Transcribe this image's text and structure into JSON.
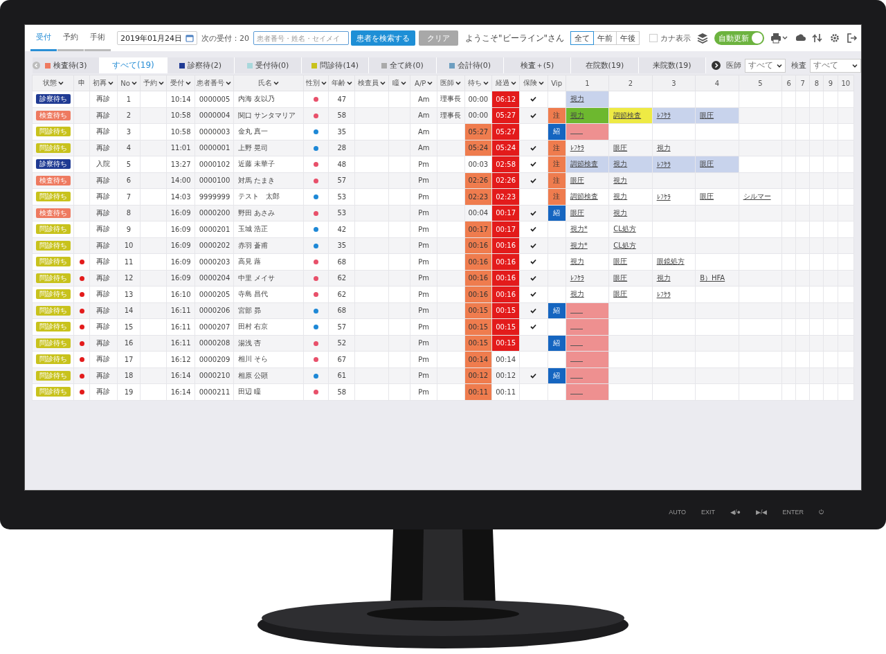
{
  "header": {
    "tabs": [
      {
        "label": "受付",
        "selected": true
      },
      {
        "label": "予約",
        "selected": false
      },
      {
        "label": "手術",
        "selected": false
      }
    ],
    "date": "2019年01月24日",
    "next_reception": "次の受付：20",
    "search": {
      "placeholder": "患者番号・姓名・セイメイ"
    },
    "buttons": [
      {
        "label": "患者を検索する",
        "disabled": false
      },
      {
        "label": "クリア",
        "disabled": true
      }
    ],
    "welcome": "ようこそ\"ビーライン\"さん",
    "period": [
      {
        "label": "全て",
        "selected": true
      },
      {
        "label": "午前",
        "selected": false
      },
      {
        "label": "午後",
        "selected": false
      }
    ],
    "kana": {
      "label": "カナ表示",
      "checked": false
    },
    "auto_update": {
      "label": "自動更新",
      "on": true
    }
  },
  "filters": {
    "tabs": [
      {
        "label": "検査待(3)",
        "color": "#ee7a60",
        "selected": false
      },
      {
        "label": "すべて(19)",
        "selected": true
      },
      {
        "label": "診察待(2)",
        "color": "#1f3a93",
        "selected": false
      },
      {
        "label": "受付待(0)",
        "color": "#a8d8dc",
        "selected": false
      },
      {
        "label": "問診待(14)",
        "color": "#c8c21c",
        "selected": false
      },
      {
        "label": "全て終(0)",
        "color": "#aaaaaa",
        "selected": false
      },
      {
        "label": "会計待(0)",
        "color": "#6d9ec0",
        "selected": false
      },
      {
        "label": "検査＋(5)",
        "selected": false
      },
      {
        "label": "在院数(19)",
        "selected": false
      },
      {
        "label": "来院数(19)",
        "selected": false
      }
    ],
    "selects": [
      {
        "label": "医師",
        "value": "すべて"
      },
      {
        "label": "検査",
        "value": "すべて"
      }
    ]
  },
  "table": {
    "columns": [
      {
        "label": "状態",
        "sortable": true
      },
      {
        "label": "申",
        "sortable": false
      },
      {
        "label": "初再",
        "sortable": true
      },
      {
        "label": "No",
        "sortable": true
      },
      {
        "label": "予約",
        "sortable": true
      },
      {
        "label": "受付",
        "sortable": true
      },
      {
        "label": "患者番号",
        "sortable": true
      },
      {
        "label": "氏名",
        "sortable": true
      },
      {
        "label": "性別",
        "sortable": true
      },
      {
        "label": "年齢",
        "sortable": true
      },
      {
        "label": "検査員",
        "sortable": true
      },
      {
        "label": "瞳",
        "sortable": true
      },
      {
        "label": "A/P",
        "sortable": true
      },
      {
        "label": "医師",
        "sortable": true
      },
      {
        "label": "待ち",
        "sortable": true
      },
      {
        "label": "経過",
        "sortable": true
      },
      {
        "label": "保険",
        "sortable": true
      },
      {
        "label": "Vip",
        "sortable": false
      },
      {
        "label": "1",
        "sortable": false
      },
      {
        "label": "2",
        "sortable": false
      },
      {
        "label": "3",
        "sortable": false
      },
      {
        "label": "4",
        "sortable": false
      },
      {
        "label": "5",
        "sortable": false
      },
      {
        "label": "6",
        "sortable": false
      },
      {
        "label": "7",
        "sortable": false
      },
      {
        "label": "8",
        "sortable": false
      },
      {
        "label": "9",
        "sortable": false
      },
      {
        "label": "10",
        "sortable": false
      }
    ],
    "rows": [
      {
        "status": {
          "label": "診察待ち",
          "color": "#1f3a93"
        },
        "flag": false,
        "visit": "再診",
        "no": "1",
        "time": "10:14",
        "patient_id": "0000005",
        "name": "内海 友以乃",
        "sex": {
          "color": "#e8506a"
        },
        "age": "47",
        "ap": "Am",
        "doctor": "理事長",
        "wait": {
          "text": "00:00",
          "alert": false
        },
        "elapsed": {
          "text": "06:12",
          "alert": true
        },
        "insured": true,
        "exams": [
          {
            "kind": "link",
            "text": "視力",
            "color": "#c8d3ec"
          }
        ]
      },
      {
        "status": {
          "label": "検査待ち",
          "color": "#ee7a60"
        },
        "flag": false,
        "visit": "再診",
        "no": "2",
        "time": "10:58",
        "patient_id": "0000004",
        "name": "関口 サンタマリア",
        "sex": {
          "color": "#e8506a"
        },
        "age": "58",
        "ap": "Am",
        "doctor": "理事長",
        "wait": {
          "text": "00:00",
          "alert": false
        },
        "elapsed": {
          "text": "05:27",
          "alert": true
        },
        "insured": true,
        "vip": {
          "kind": "caution",
          "label": "注"
        },
        "exams": [
          {
            "kind": "link",
            "text": "視力",
            "color": "#6db82f"
          },
          {
            "kind": "link",
            "text": "調節検査",
            "color": "#eeea44"
          },
          {
            "kind": "link",
            "text": "ﾚﾌｹﾗ",
            "color": "#c8d3ec"
          },
          {
            "kind": "link",
            "text": "眼圧",
            "color": "#c8d3ec"
          }
        ]
      },
      {
        "status": {
          "label": "問診待ち",
          "color": "#c8c21c"
        },
        "flag": false,
        "visit": "再診",
        "no": "3",
        "time": "10:58",
        "patient_id": "0000003",
        "name": "金丸 真一",
        "sex": {
          "color": "#1e88d6"
        },
        "age": "35",
        "ap": "Am",
        "wait": {
          "text": "05:27",
          "alert": true
        },
        "elapsed": {
          "text": "05:27",
          "alert": true
        },
        "insured": false,
        "vip": {
          "kind": "referral",
          "label": "紹"
        },
        "exams": [
          {
            "kind": "blank",
            "color": "#ee9090"
          }
        ]
      },
      {
        "status": {
          "label": "問診待ち",
          "color": "#c8c21c"
        },
        "flag": false,
        "visit": "再診",
        "no": "4",
        "time": "11:01",
        "patient_id": "0000001",
        "name": "上野 晃司",
        "sex": {
          "color": "#1e88d6"
        },
        "age": "28",
        "ap": "Am",
        "wait": {
          "text": "05:24",
          "alert": true
        },
        "elapsed": {
          "text": "05:24",
          "alert": true
        },
        "insured": true,
        "vip": {
          "kind": "caution",
          "label": "注"
        },
        "exams": [
          {
            "kind": "link",
            "text": "ﾚﾌｹﾗ"
          },
          {
            "kind": "link",
            "text": "眼圧"
          },
          {
            "kind": "link",
            "text": "視力"
          }
        ]
      },
      {
        "status": {
          "label": "診察待ち",
          "color": "#1f3a93"
        },
        "flag": false,
        "visit": "入院",
        "no": "5",
        "time": "13:27",
        "patient_id": "0000102",
        "name": "近藤 未華子",
        "sex": {
          "color": "#e8506a"
        },
        "age": "48",
        "ap": "Pm",
        "wait": {
          "text": "00:03",
          "alert": false
        },
        "elapsed": {
          "text": "02:58",
          "alert": true
        },
        "insured": true,
        "vip": {
          "kind": "caution",
          "label": "注"
        },
        "exams": [
          {
            "kind": "link",
            "text": "調節検査",
            "color": "#c8d3ec"
          },
          {
            "kind": "link",
            "text": "視力",
            "color": "#c8d3ec"
          },
          {
            "kind": "link",
            "text": "ﾚﾌｹﾗ",
            "color": "#c8d3ec"
          },
          {
            "kind": "link",
            "text": "眼圧",
            "color": "#c8d3ec"
          }
        ]
      },
      {
        "status": {
          "label": "検査待ち",
          "color": "#ee7a60"
        },
        "flag": false,
        "visit": "再診",
        "no": "6",
        "time": "14:00",
        "patient_id": "0000100",
        "name": "対馬 たまき",
        "sex": {
          "color": "#e8506a"
        },
        "age": "57",
        "ap": "Pm",
        "wait": {
          "text": "02:26",
          "alert": true
        },
        "elapsed": {
          "text": "02:26",
          "alert": true
        },
        "insured": true,
        "vip": {
          "kind": "caution",
          "label": "注"
        },
        "exams": [
          {
            "kind": "link",
            "text": "眼圧"
          },
          {
            "kind": "link",
            "text": "視力"
          }
        ]
      },
      {
        "status": {
          "label": "問診待ち",
          "color": "#c8c21c"
        },
        "flag": false,
        "visit": "再診",
        "no": "7",
        "time": "14:03",
        "patient_id": "9999999",
        "name": "テスト　太郎",
        "sex": {
          "color": "#1e88d6"
        },
        "age": "53",
        "ap": "Pm",
        "wait": {
          "text": "02:23",
          "alert": true
        },
        "elapsed": {
          "text": "02:23",
          "alert": true
        },
        "insured": false,
        "vip": {
          "kind": "caution",
          "label": "注"
        },
        "exams": [
          {
            "kind": "link",
            "text": "調節検査"
          },
          {
            "kind": "link",
            "text": "視力"
          },
          {
            "kind": "link",
            "text": "ﾚﾌｹﾗ"
          },
          {
            "kind": "link",
            "text": "眼圧"
          },
          {
            "kind": "link",
            "text": "シルマー"
          }
        ]
      },
      {
        "status": {
          "label": "検査待ち",
          "color": "#ee7a60"
        },
        "flag": false,
        "visit": "再診",
        "no": "8",
        "time": "16:09",
        "patient_id": "0000200",
        "name": "野田 あさみ",
        "sex": {
          "color": "#e8506a"
        },
        "age": "53",
        "ap": "Pm",
        "wait": {
          "text": "00:04",
          "alert": false
        },
        "elapsed": {
          "text": "00:17",
          "alert": true
        },
        "insured": true,
        "vip": {
          "kind": "referral",
          "label": "紹"
        },
        "exams": [
          {
            "kind": "link",
            "text": "眼圧"
          },
          {
            "kind": "link",
            "text": "視力"
          }
        ]
      },
      {
        "status": {
          "label": "問診待ち",
          "color": "#c8c21c"
        },
        "flag": false,
        "visit": "再診",
        "no": "9",
        "time": "16:09",
        "patient_id": "0000201",
        "name": "玉城 浩正",
        "sex": {
          "color": "#1e88d6"
        },
        "age": "42",
        "ap": "Pm",
        "wait": {
          "text": "00:17",
          "alert": true
        },
        "elapsed": {
          "text": "00:17",
          "alert": true
        },
        "insured": true,
        "exams": [
          {
            "kind": "link",
            "text": "視力*"
          },
          {
            "kind": "link",
            "text": "CL処方"
          }
        ]
      },
      {
        "status": {
          "label": "問診待ち",
          "color": "#c8c21c"
        },
        "flag": false,
        "visit": "再診",
        "no": "10",
        "time": "16:09",
        "patient_id": "0000202",
        "name": "赤羽 蒼甫",
        "sex": {
          "color": "#1e88d6"
        },
        "age": "35",
        "ap": "Pm",
        "wait": {
          "text": "00:16",
          "alert": true
        },
        "elapsed": {
          "text": "00:16",
          "alert": true
        },
        "insured": true,
        "exams": [
          {
            "kind": "link",
            "text": "視力*"
          },
          {
            "kind": "link",
            "text": "CL処方"
          }
        ]
      },
      {
        "status": {
          "label": "問診待ち",
          "color": "#c8c21c"
        },
        "flag": true,
        "visit": "再診",
        "no": "11",
        "time": "16:09",
        "patient_id": "0000203",
        "name": "高見 蕗",
        "sex": {
          "color": "#e8506a"
        },
        "age": "68",
        "ap": "Pm",
        "wait": {
          "text": "00:16",
          "alert": true
        },
        "elapsed": {
          "text": "00:16",
          "alert": true
        },
        "insured": true,
        "exams": [
          {
            "kind": "link",
            "text": "視力"
          },
          {
            "kind": "link",
            "text": "眼圧"
          },
          {
            "kind": "link",
            "text": "眼鏡処方"
          }
        ]
      },
      {
        "status": {
          "label": "問診待ち",
          "color": "#c8c21c"
        },
        "flag": true,
        "visit": "再診",
        "no": "12",
        "time": "16:09",
        "patient_id": "0000204",
        "name": "中里 メイサ",
        "sex": {
          "color": "#e8506a"
        },
        "age": "62",
        "ap": "Pm",
        "wait": {
          "text": "00:16",
          "alert": true
        },
        "elapsed": {
          "text": "00:16",
          "alert": true
        },
        "insured": true,
        "exams": [
          {
            "kind": "link",
            "text": "ﾚﾌｹﾗ"
          },
          {
            "kind": "link",
            "text": "眼圧"
          },
          {
            "kind": "link",
            "text": "視力"
          },
          {
            "kind": "link",
            "text": "B）HFA"
          }
        ]
      },
      {
        "status": {
          "label": "問診待ち",
          "color": "#c8c21c"
        },
        "flag": true,
        "visit": "再診",
        "no": "13",
        "time": "16:10",
        "patient_id": "0000205",
        "name": "寺島 昌代",
        "sex": {
          "color": "#e8506a"
        },
        "age": "62",
        "ap": "Pm",
        "wait": {
          "text": "00:16",
          "alert": true
        },
        "elapsed": {
          "text": "00:16",
          "alert": true
        },
        "insured": true,
        "exams": [
          {
            "kind": "link",
            "text": "視力"
          },
          {
            "kind": "link",
            "text": "眼圧"
          },
          {
            "kind": "link",
            "text": "ﾚﾌｹﾗ"
          }
        ]
      },
      {
        "status": {
          "label": "問診待ち",
          "color": "#c8c21c"
        },
        "flag": true,
        "visit": "再診",
        "no": "14",
        "time": "16:11",
        "patient_id": "0000206",
        "name": "宮部 昴",
        "sex": {
          "color": "#1e88d6"
        },
        "age": "68",
        "ap": "Pm",
        "wait": {
          "text": "00:15",
          "alert": true
        },
        "elapsed": {
          "text": "00:15",
          "alert": true
        },
        "insured": true,
        "vip": {
          "kind": "referral",
          "label": "紹"
        },
        "exams": [
          {
            "kind": "blank",
            "color": "#ee9090"
          }
        ]
      },
      {
        "status": {
          "label": "問診待ち",
          "color": "#c8c21c"
        },
        "flag": true,
        "visit": "再診",
        "no": "15",
        "time": "16:11",
        "patient_id": "0000207",
        "name": "田村 右京",
        "sex": {
          "color": "#1e88d6"
        },
        "age": "57",
        "ap": "Pm",
        "wait": {
          "text": "00:15",
          "alert": true
        },
        "elapsed": {
          "text": "00:15",
          "alert": true
        },
        "insured": true,
        "exams": [
          {
            "kind": "blank",
            "color": "#ee9090"
          }
        ]
      },
      {
        "status": {
          "label": "問診待ち",
          "color": "#c8c21c"
        },
        "flag": true,
        "visit": "再診",
        "no": "16",
        "time": "16:11",
        "patient_id": "0000208",
        "name": "湯浅 杏",
        "sex": {
          "color": "#e8506a"
        },
        "age": "52",
        "ap": "Pm",
        "wait": {
          "text": "00:15",
          "alert": true
        },
        "elapsed": {
          "text": "00:15",
          "alert": true
        },
        "insured": false,
        "vip": {
          "kind": "referral",
          "label": "紹"
        },
        "exams": [
          {
            "kind": "blank",
            "color": "#ee9090"
          }
        ]
      },
      {
        "status": {
          "label": "問診待ち",
          "color": "#c8c21c"
        },
        "flag": true,
        "visit": "再診",
        "no": "17",
        "time": "16:12",
        "patient_id": "0000209",
        "name": "相川 そら",
        "sex": {
          "color": "#e8506a"
        },
        "age": "67",
        "ap": "Pm",
        "wait": {
          "text": "00:14",
          "alert": true
        },
        "elapsed": {
          "text": "00:14",
          "alert": false
        },
        "insured": false,
        "exams": [
          {
            "kind": "blank",
            "color": "#ee9090"
          }
        ]
      },
      {
        "status": {
          "label": "問診待ち",
          "color": "#c8c21c"
        },
        "flag": true,
        "visit": "再診",
        "no": "18",
        "time": "16:14",
        "patient_id": "0000210",
        "name": "相原 公顕",
        "sex": {
          "color": "#1e88d6"
        },
        "age": "61",
        "ap": "Pm",
        "wait": {
          "text": "00:12",
          "alert": true
        },
        "elapsed": {
          "text": "00:12",
          "alert": false
        },
        "insured": true,
        "vip": {
          "kind": "referral",
          "label": "紹"
        },
        "exams": [
          {
            "kind": "blank",
            "color": "#ee9090"
          }
        ]
      },
      {
        "status": {
          "label": "問診待ち",
          "color": "#c8c21c"
        },
        "flag": true,
        "visit": "再診",
        "no": "19",
        "time": "16:14",
        "patient_id": "0000211",
        "name": "田辺 瞳",
        "sex": {
          "color": "#e8506a"
        },
        "age": "58",
        "ap": "Pm",
        "wait": {
          "text": "00:11",
          "alert": true
        },
        "elapsed": {
          "text": "00:11",
          "alert": false
        },
        "insured": false,
        "exams": [
          {
            "kind": "blank",
            "color": "#ee9090"
          }
        ]
      }
    ]
  },
  "monitor": {
    "buttons": [
      "AUTO",
      "EXIT",
      "◀/●",
      "▶/◀",
      "ENTER",
      "⏻"
    ]
  }
}
